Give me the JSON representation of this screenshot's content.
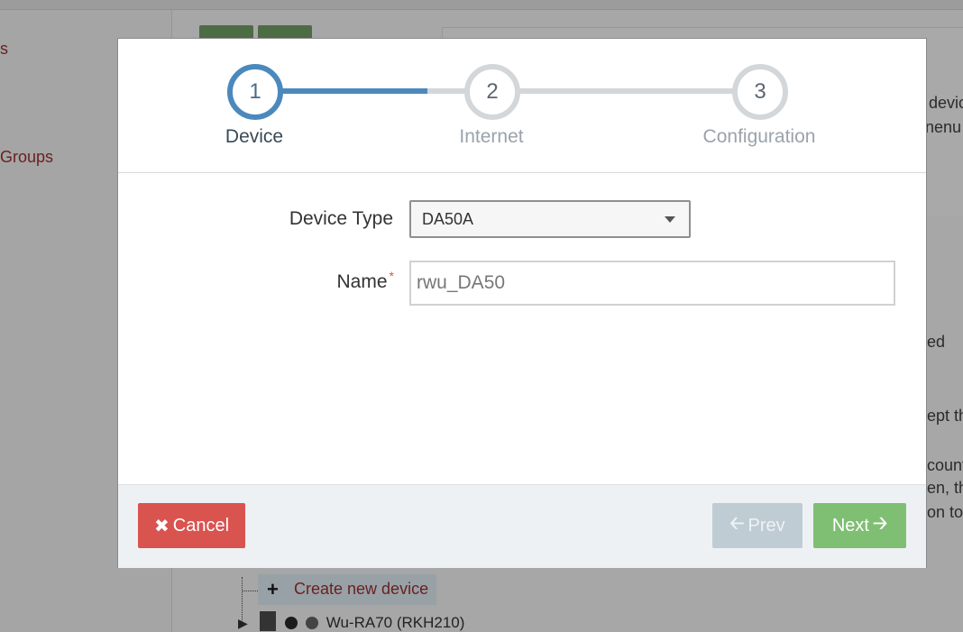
{
  "background": {
    "sidebar_links": [
      "s",
      "Groups"
    ],
    "panel_text_fragments": [
      "devic",
      "nenu (",
      "ed",
      "ept th",
      "count",
      "en, th",
      "on to"
    ],
    "tree": {
      "create_label": "Create new device",
      "device_label": "Wu-RA70 (RKH210)"
    }
  },
  "wizard": {
    "steps": [
      {
        "number": "1",
        "label": "Device"
      },
      {
        "number": "2",
        "label": "Internet"
      },
      {
        "number": "3",
        "label": "Configuration"
      }
    ],
    "active_step": 1,
    "progress_fraction": 0.32
  },
  "form": {
    "device_type_label": "Device Type",
    "device_type_value": "DA50A",
    "name_label": "Name",
    "name_required_mark": "*",
    "name_value": "rwu_DA50"
  },
  "footer": {
    "cancel_label": "Cancel",
    "prev_label": "Prev",
    "next_label": "Next"
  },
  "colors": {
    "accent": "#4b89bd",
    "cancel": "#d9534f",
    "next": "#7fbf73",
    "prev_disabled": "#bfccd3"
  }
}
